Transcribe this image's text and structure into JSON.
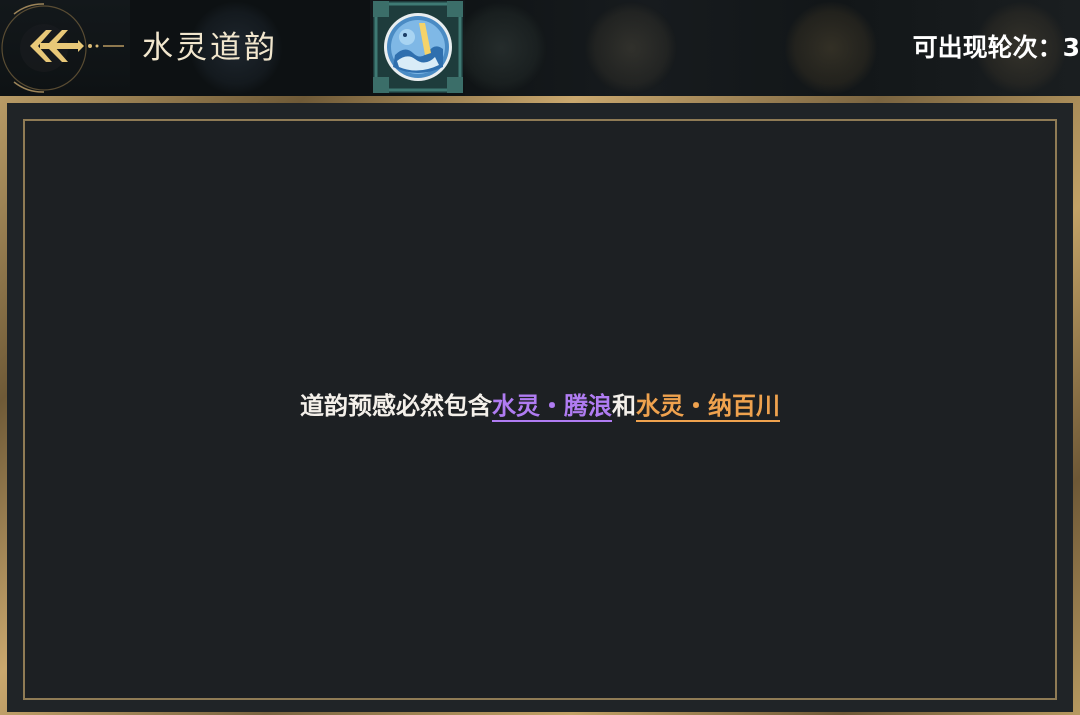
{
  "header": {
    "title": "水灵道韵",
    "rounds_label": "可出现轮次：3",
    "back_icon": "double-chevron-left-icon",
    "selected_icon": "water-spirit-wave-icon"
  },
  "message": {
    "prefix": "道韵预感必然包含",
    "link1": "水灵・腾浪",
    "connector": "和",
    "link2": "水灵・纳百川"
  },
  "colors": {
    "accent_gold": "#d9b974",
    "link1_purple": "#b07cf2",
    "link2_orange": "#efa24e",
    "panel_bg": "#1d2023",
    "frame_gold": "#b89b66"
  }
}
